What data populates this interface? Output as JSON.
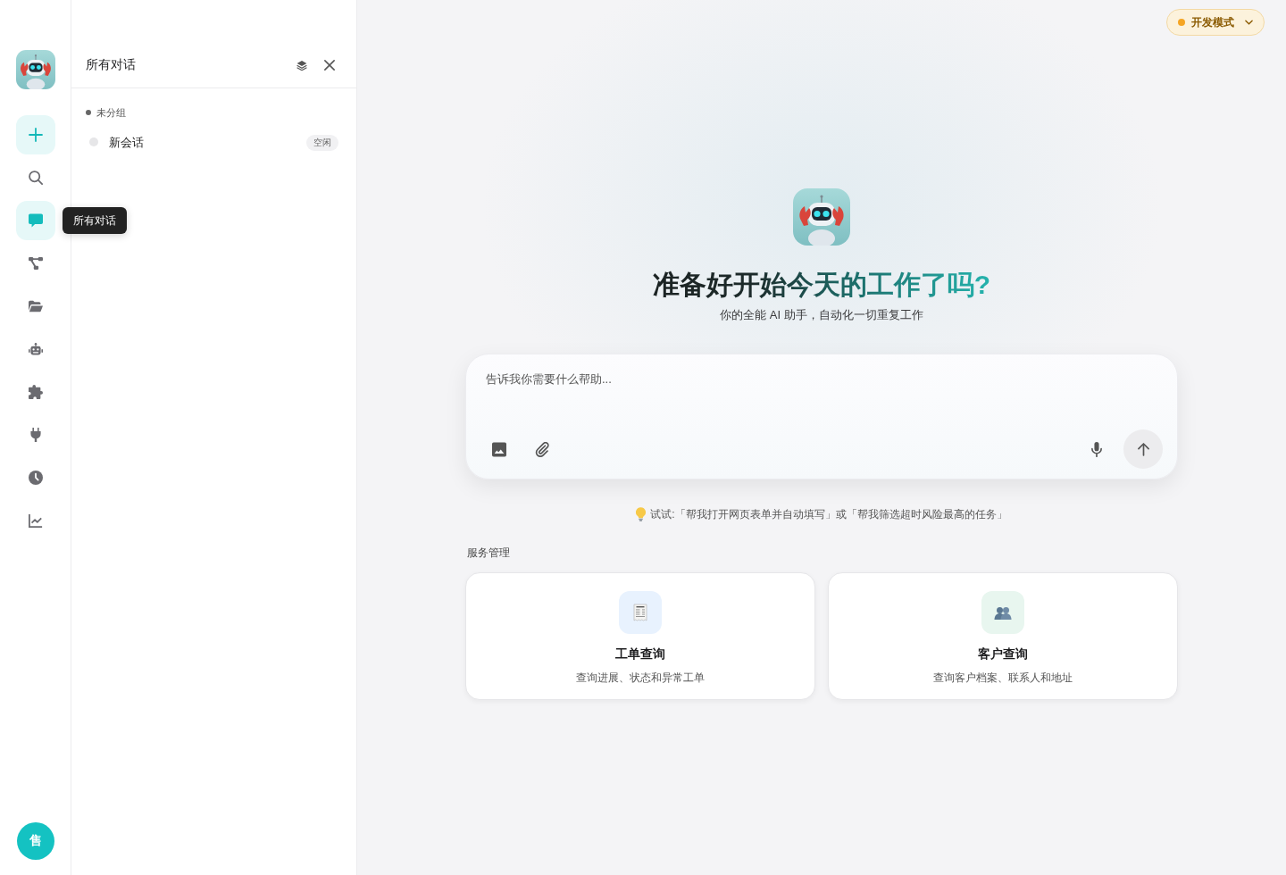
{
  "rail": {
    "items": [
      {
        "selected": false
      },
      {
        "selected": true
      },
      {
        "selected": false
      },
      {
        "selected": false
      },
      {
        "selected": false
      },
      {
        "selected": false
      },
      {
        "selected": false
      },
      {
        "selected": false
      },
      {
        "selected": false
      }
    ],
    "avatar": "售"
  },
  "tooltip": {
    "label": "所有对话"
  },
  "panel": {
    "title": "所有对话",
    "groups": [
      {
        "label": "未分组",
        "sessions": [
          {
            "title": "新会话",
            "status": "空闲"
          }
        ]
      }
    ]
  },
  "mode_badge": {
    "label": "开发模式"
  },
  "hero": {
    "title": "准备好开始今天的工作了吗?",
    "subtitle": "你的全能 AI 助手，自动化一切重复工作"
  },
  "composer": {
    "placeholder": "告诉我你需要什么帮助..."
  },
  "hint": "试试:「帮我打开网页表单并自动填写」或「帮我筛选超时风险最高的任务」",
  "services": {
    "title": "服务管理",
    "cards": [
      {
        "title": "工单查询",
        "description": "查询进展、状态和异常工单",
        "color": "#e8f2fe"
      },
      {
        "title": "客户查询",
        "description": "查询客户档案、联系人和地址",
        "color": "#e8f6ef"
      }
    ]
  }
}
